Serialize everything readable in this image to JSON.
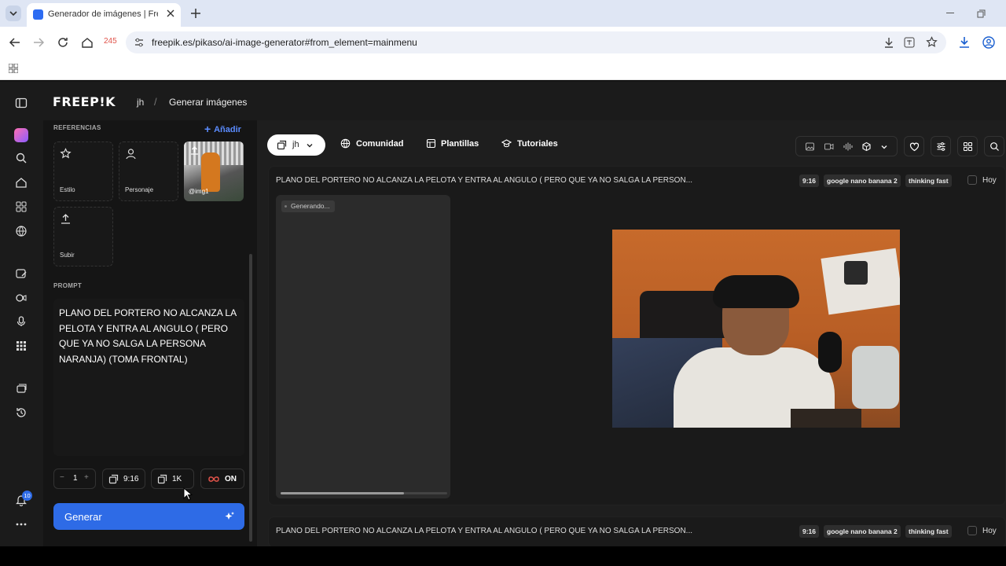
{
  "browser": {
    "tab_title": "Generador de imágenes | Freepik",
    "counter": "245",
    "url": "freepik.es/pikaso/ai-image-generator#from_element=mainmenu"
  },
  "header": {
    "logo": "FREEP!K",
    "breadcrumb_workspace": "jh",
    "breadcrumb_sep": "/",
    "breadcrumb_page": "Generar imágenes"
  },
  "sidebar": {
    "notification_count": "10"
  },
  "panel": {
    "references_label": "REFERENCIAS",
    "add_label": "Añadir",
    "ref_style": "Estilo",
    "ref_character": "Personaje",
    "ref_image": "@img1",
    "ref_upload": "Subir",
    "prompt_label": "PROMPT",
    "prompt_text": "PLANO DEL PORTERO NO ALCANZA LA PELOTA Y ENTRA AL ANGULO ( PERO QUE YA NO SALGA LA PERSONA NARANJA) (TOMA FRONTAL)",
    "count": "1",
    "minus": "−",
    "plus": "+",
    "aspect": "9:16",
    "resolution": "1K",
    "mode": "ON",
    "generate": "Generar"
  },
  "nav": {
    "workspace": "jh",
    "community": "Comunidad",
    "templates": "Plantillas",
    "tutorials": "Tutoriales"
  },
  "feed": [
    {
      "prompt": "PLANO DEL PORTERO NO ALCANZA LA PELOTA Y ENTRA AL ANGULO ( PERO QUE YA NO SALGA LA PERSON...",
      "aspect": "9:16",
      "model": "google nano banana 2",
      "speed": "thinking fast",
      "date": "Hoy",
      "status": "Generando...",
      "progress": 0.74
    },
    {
      "prompt": "PLANO DEL PORTERO NO ALCANZA LA PELOTA Y ENTRA AL ANGULO ( PERO QUE YA NO SALGA LA PERSON...",
      "aspect": "9:16",
      "model": "google nano banana 2",
      "speed": "thinking fast",
      "date": "Hoy"
    }
  ],
  "colors": {
    "accent": "#2e6be6",
    "app_bg": "#1b1b1b",
    "add_link": "#5b8cff",
    "upscale_icon": "#e0534a"
  }
}
